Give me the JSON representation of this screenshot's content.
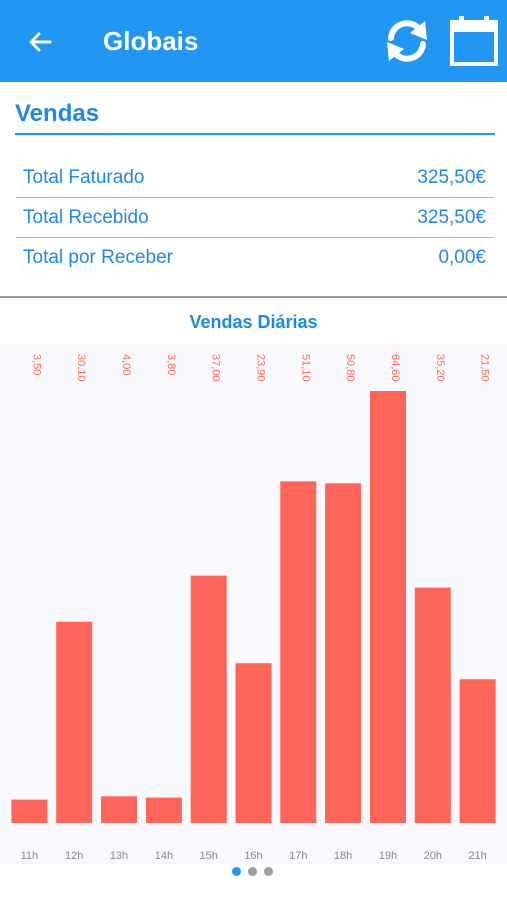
{
  "appbar": {
    "title": "Globais",
    "back_icon": "arrow-left-icon",
    "refresh_icon": "refresh-icon",
    "calendar_icon": "calendar-icon",
    "color": "#2196f3"
  },
  "sales": {
    "title": "Vendas",
    "rows": [
      {
        "label": "Total Faturado",
        "value": "325,50€"
      },
      {
        "label": "Total Recebido",
        "value": "325,50€"
      },
      {
        "label": "Total por Receber",
        "value": "0,00€"
      }
    ]
  },
  "chart_title": "Vendas Diárias",
  "chart_data": {
    "type": "bar",
    "categories": [
      "11h",
      "12h",
      "13h",
      "14h",
      "15h",
      "16h",
      "17h",
      "18h",
      "19h",
      "20h",
      "21h"
    ],
    "values": [
      3.5,
      30.1,
      4.0,
      3.8,
      37.0,
      23.9,
      51.1,
      50.8,
      64.6,
      35.2,
      21.5
    ],
    "value_labels": [
      "3,50",
      "30,10",
      "4,00",
      "3,80",
      "37,00",
      "23,90",
      "51,10",
      "50,80",
      "64,60",
      "35,20",
      "21,50"
    ],
    "bar_color": "#ff6659",
    "ylim": [
      0,
      64.6
    ]
  },
  "pager": {
    "count": 3,
    "active": 0,
    "active_color": "#2196f3",
    "inactive_color": "#9e9e9e"
  }
}
